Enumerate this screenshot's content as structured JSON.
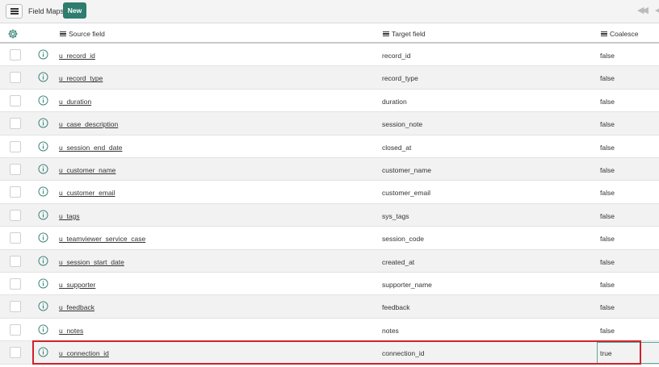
{
  "toolbar": {
    "title": "Field Maps",
    "new_label": "New",
    "menu_icon": "hamburger-icon",
    "nav_first_glyph": "◀◀",
    "nav_prev_glyph": "◀"
  },
  "columns": {
    "source": "Source field",
    "target": "Target field",
    "coalesce": "Coalesce"
  },
  "colors": {
    "accent": "#2e7d6f",
    "highlight": "#d0212a",
    "row_alt": "#f2f2f2"
  },
  "rows": [
    {
      "source": "u_record_id",
      "target": "record_id",
      "coalesce": "false"
    },
    {
      "source": "u_record_type",
      "target": "record_type",
      "coalesce": "false"
    },
    {
      "source": "u_duration",
      "target": "duration",
      "coalesce": "false"
    },
    {
      "source": "u_case_description",
      "target": "session_note",
      "coalesce": "false"
    },
    {
      "source": "u_session_end_date",
      "target": "closed_at",
      "coalesce": "false"
    },
    {
      "source": "u_customer_name",
      "target": "customer_name",
      "coalesce": "false"
    },
    {
      "source": "u_customer_email",
      "target": "customer_email",
      "coalesce": "false"
    },
    {
      "source": "u_tags",
      "target": "sys_tags",
      "coalesce": "false"
    },
    {
      "source": "u_teamviewer_service_case",
      "target": "session_code",
      "coalesce": "false"
    },
    {
      "source": "u_session_start_date",
      "target": "created_at",
      "coalesce": "false"
    },
    {
      "source": "u_supporter",
      "target": "supporter_name",
      "coalesce": "false"
    },
    {
      "source": "u_feedback",
      "target": "feedback",
      "coalesce": "false"
    },
    {
      "source": "u_notes",
      "target": "notes",
      "coalesce": "false"
    },
    {
      "source": "u_connection_id",
      "target": "connection_id",
      "coalesce": "true"
    }
  ]
}
